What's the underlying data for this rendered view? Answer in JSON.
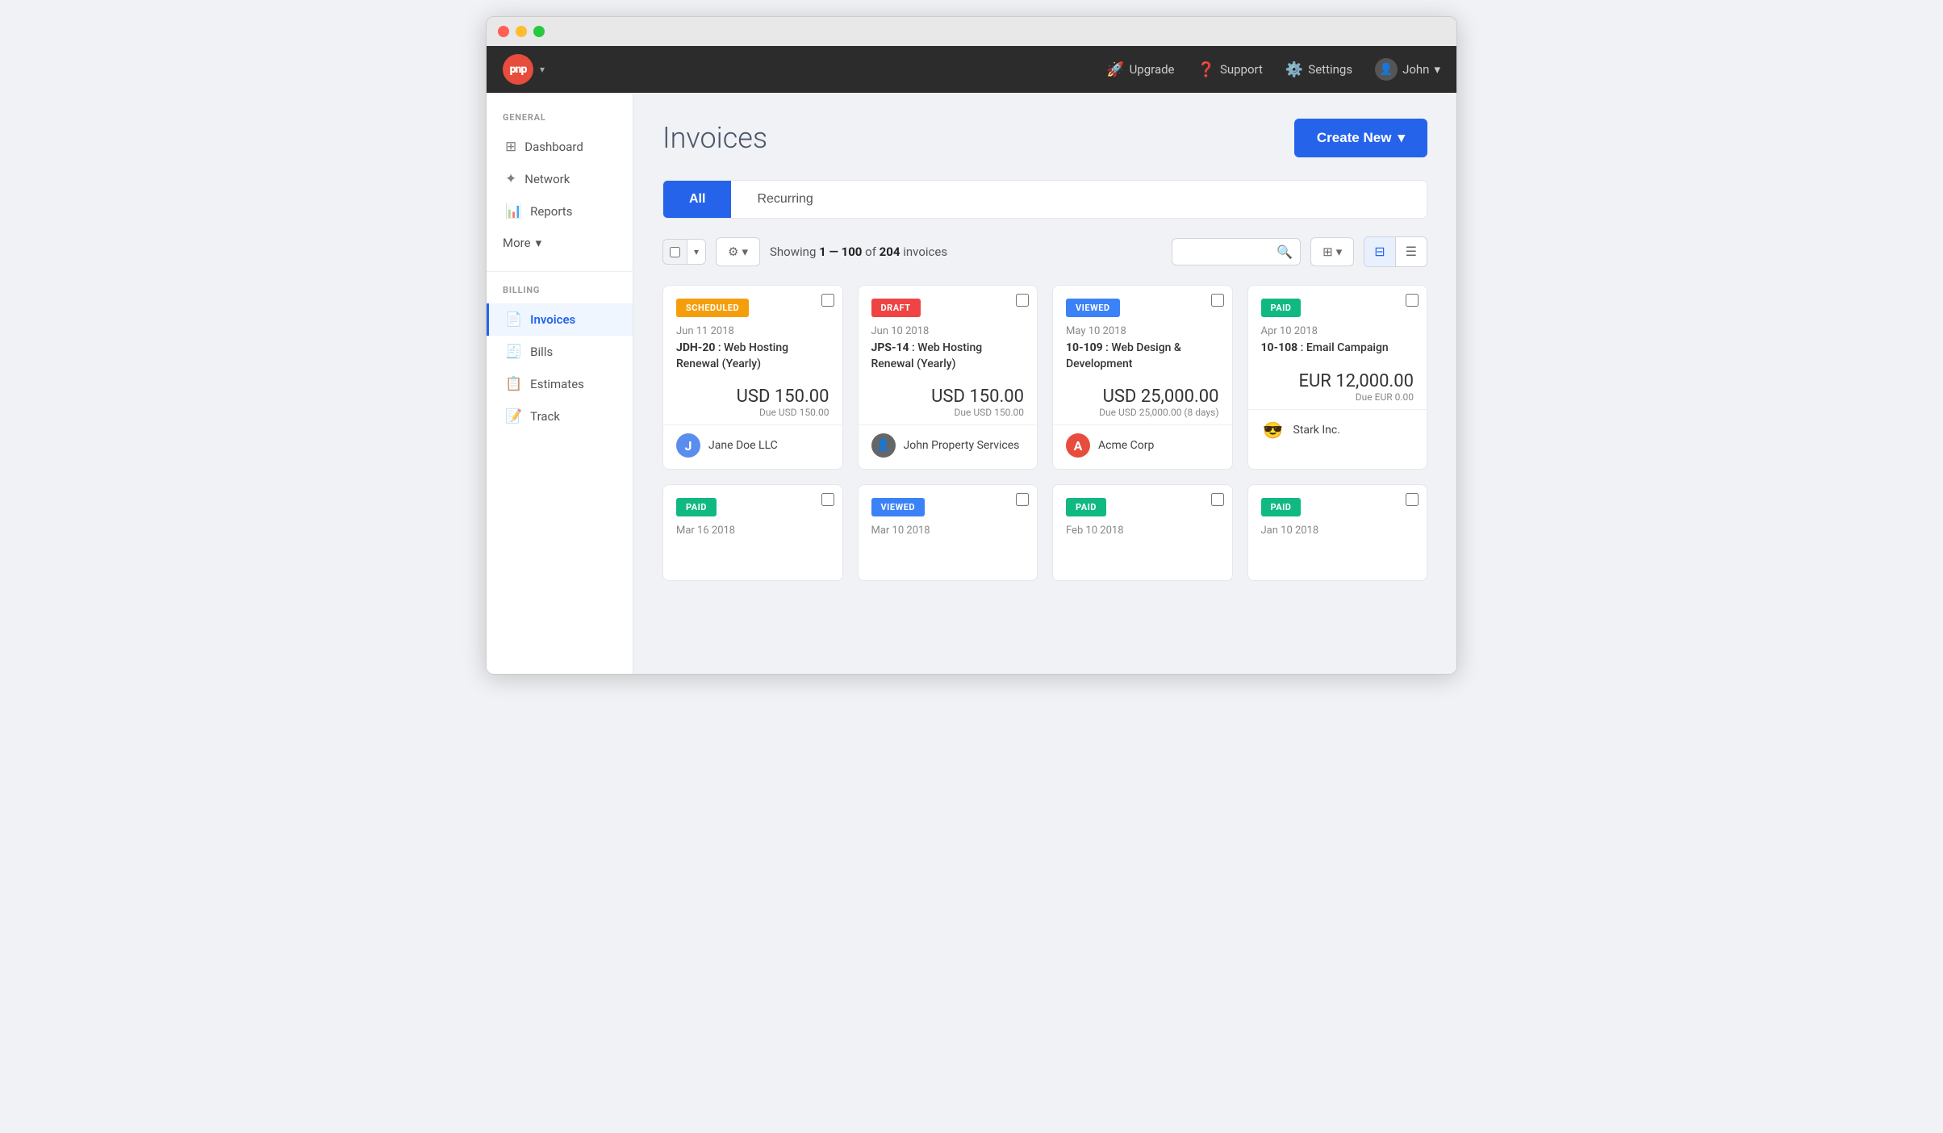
{
  "window": {
    "titlebar_btns": [
      "#ff5f57",
      "#febc2e",
      "#28c840"
    ]
  },
  "topnav": {
    "logo_text": "pnp",
    "upgrade_label": "Upgrade",
    "support_label": "Support",
    "settings_label": "Settings",
    "user_label": "John",
    "user_caret": "▾"
  },
  "sidebar": {
    "general_label": "GENERAL",
    "billing_label": "BILLING",
    "items_general": [
      {
        "id": "dashboard",
        "label": "Dashboard",
        "icon": "⊞",
        "active": false
      },
      {
        "id": "network",
        "label": "Network",
        "icon": "✦",
        "active": false
      },
      {
        "id": "reports",
        "label": "Reports",
        "icon": "📊",
        "active": false
      }
    ],
    "more_label": "More",
    "items_billing": [
      {
        "id": "invoices",
        "label": "Invoices",
        "icon": "📄",
        "active": true
      },
      {
        "id": "bills",
        "label": "Bills",
        "icon": "🧾",
        "active": false
      },
      {
        "id": "estimates",
        "label": "Estimates",
        "icon": "📋",
        "active": false
      },
      {
        "id": "track",
        "label": "Track",
        "icon": "📝",
        "active": false
      }
    ]
  },
  "page": {
    "title": "Invoices",
    "create_btn_label": "Create New",
    "tabs": [
      {
        "id": "all",
        "label": "All",
        "active": true
      },
      {
        "id": "recurring",
        "label": "Recurring",
        "active": false
      }
    ],
    "showing_text": "Showing",
    "showing_range": "1 — 100",
    "showing_of": "of",
    "showing_total": "204",
    "showing_suffix": "invoices"
  },
  "invoices": [
    {
      "status": "SCHEDULED",
      "status_class": "scheduled",
      "date": "Jun 11 2018",
      "invoice_id": "JDH-20",
      "description": "Web Hosting Renewal (Yearly)",
      "amount": "USD 150.00",
      "due": "Due USD 150.00",
      "client_name": "Jane Doe LLC",
      "client_avatar_type": "letter",
      "client_avatar_letter": "J",
      "client_avatar_class": "avatar-j"
    },
    {
      "status": "DRAFT",
      "status_class": "draft",
      "date": "Jun 10 2018",
      "invoice_id": "JPS-14",
      "description": "Web Hosting Renewal (Yearly)",
      "amount": "USD 150.00",
      "due": "Due USD 150.00",
      "client_name": "John Property Services",
      "client_avatar_type": "photo",
      "client_avatar_class": "avatar-p"
    },
    {
      "status": "VIEWED",
      "status_class": "viewed",
      "date": "May 10 2018",
      "invoice_id": "10-109",
      "description": "Web Design & Development",
      "amount": "USD 25,000.00",
      "due": "Due USD 25,000.00 (8 days)",
      "client_name": "Acme Corp",
      "client_avatar_type": "letter",
      "client_avatar_letter": "A",
      "client_avatar_class": "avatar-a"
    },
    {
      "status": "PAID",
      "status_class": "paid",
      "date": "Apr 10 2018",
      "invoice_id": "10-108",
      "description": "Email Campaign",
      "amount": "EUR 12,000.00",
      "due": "Due EUR 0.00",
      "client_name": "Stark Inc.",
      "client_avatar_type": "emoji",
      "client_avatar_emoji": "😎",
      "client_avatar_class": "avatar-s"
    }
  ],
  "invoices_row2": [
    {
      "status": "PAID",
      "status_class": "paid",
      "date": "Mar 16 2018"
    },
    {
      "status": "VIEWED",
      "status_class": "viewed",
      "date": "Mar 10 2018"
    },
    {
      "status": "PAID",
      "status_class": "paid",
      "date": "Feb 10 2018"
    },
    {
      "status": "PAID",
      "status_class": "paid",
      "date": "Jan 10 2018"
    }
  ]
}
